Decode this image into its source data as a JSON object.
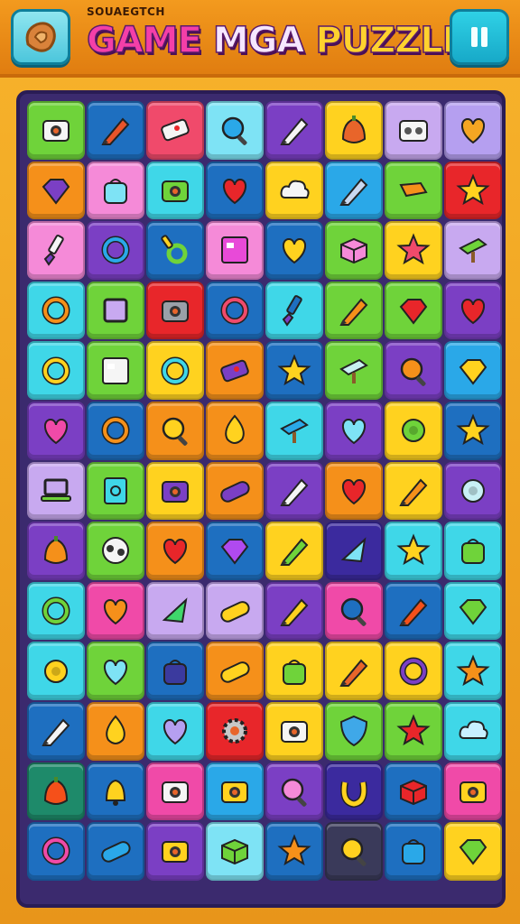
{
  "header": {
    "subtitle": "SOUAEGTCH",
    "title_part1": "GAME",
    "title_part2": "MGA",
    "title_part3": "PUZZLE",
    "menu_icon": "cookie-icon",
    "pause_icon": "pause-icon"
  },
  "board": {
    "columns": 8,
    "rows": 13,
    "tiles": [
      [
        "#6fd33a",
        "camera",
        "#f5f5f5"
      ],
      [
        "#1e6fc0",
        "pencil",
        "#e8542a"
      ],
      [
        "#f04a6b",
        "eraser",
        "#f5f5f5"
      ],
      [
        "#7ee3f5",
        "magnifier",
        "#2aa8e8"
      ],
      [
        "#7b3fc4",
        "pencil",
        "#f5f5f5"
      ],
      [
        "#ffd21f",
        "acorn",
        "#e8652a"
      ],
      [
        "#c8a9f0",
        "tape",
        "#f5f5f5"
      ],
      [
        "#b59ff0",
        "heart",
        "#f5a623"
      ],
      [
        "#f5901a",
        "gem",
        "#7b3fc4"
      ],
      [
        "#f58ad8",
        "bag",
        "#7ee3f5"
      ],
      [
        "#3fd7e8",
        "camera",
        "#6fd33a"
      ],
      [
        "#1e6fc0",
        "heart",
        "#e8262a"
      ],
      [
        "#ffd21f",
        "cloud",
        "#f5f5f5"
      ],
      [
        "#2aa8e8",
        "pencil",
        "#c8d8f0"
      ],
      [
        "#6fd33a",
        "block",
        "#f5901a"
      ],
      [
        "#e8262a",
        "star",
        "#ffd21f"
      ],
      [
        "#f58ad8",
        "brush",
        "#f5f5f5"
      ],
      [
        "#7b3fc4",
        "ring",
        "#2aa8e8"
      ],
      [
        "#1e6fc0",
        "key",
        "#6fd33a"
      ],
      [
        "#f58ad8",
        "card",
        "#e84ad8"
      ],
      [
        "#1e6fc0",
        "heart",
        "#ffd21f"
      ],
      [
        "#6fd33a",
        "box",
        "#f58ad8"
      ],
      [
        "#ffd21f",
        "star",
        "#f04a6b"
      ],
      [
        "#c8a9f0",
        "sign",
        "#6fd33a"
      ],
      [
        "#3fd7e8",
        "ring",
        "#f5901a"
      ],
      [
        "#6fd33a",
        "square",
        "#c8a9f0"
      ],
      [
        "#e8262a",
        "camera",
        "#9aa0a8"
      ],
      [
        "#1e6fc0",
        "ring",
        "#f04a6b"
      ],
      [
        "#3fd7e8",
        "brush",
        "#1e6fc0"
      ],
      [
        "#6fd33a",
        "pencil",
        "#f5901a"
      ],
      [
        "#6fd33a",
        "gem",
        "#e8262a"
      ],
      [
        "#7b3fc4",
        "heart",
        "#e8262a"
      ],
      [
        "#3fd7e8",
        "ring",
        "#ffd21f"
      ],
      [
        "#6fd33a",
        "card",
        "#f5f5f5"
      ],
      [
        "#ffd21f",
        "ring",
        "#3fd7e8"
      ],
      [
        "#f5901a",
        "eraser",
        "#7b3fc4"
      ],
      [
        "#1e6fc0",
        "star",
        "#ffd21f"
      ],
      [
        "#6fd33a",
        "sign",
        "#c8f0f0"
      ],
      [
        "#7b3fc4",
        "magnifier",
        "#f5901a"
      ],
      [
        "#2aa8e8",
        "gem",
        "#ffd21f"
      ],
      [
        "#7b3fc4",
        "heart",
        "#f04aa8"
      ],
      [
        "#1e6fc0",
        "ring",
        "#f5901a"
      ],
      [
        "#f5901a",
        "magnifier",
        "#ffd21f"
      ],
      [
        "#f5901a",
        "drop",
        "#ffd21f"
      ],
      [
        "#3fd7e8",
        "sign",
        "#2aa8e8"
      ],
      [
        "#7b3fc4",
        "heart",
        "#7ee3f5"
      ],
      [
        "#ffd21f",
        "flower",
        "#6fd33a"
      ],
      [
        "#1e6fc0",
        "star",
        "#ffd21f"
      ],
      [
        "#c8a9f0",
        "laptop",
        "#6fd33a"
      ],
      [
        "#6fd33a",
        "book",
        "#3fd7e8"
      ],
      [
        "#ffd21f",
        "camera",
        "#7b3fc4"
      ],
      [
        "#f5901a",
        "pill",
        "#7b3fc4"
      ],
      [
        "#7b3fc4",
        "pencil",
        "#f5f5f5"
      ],
      [
        "#f5901a",
        "heart",
        "#e8262a"
      ],
      [
        "#ffd21f",
        "pencil",
        "#f5901a"
      ],
      [
        "#7b3fc4",
        "flower",
        "#c8f0f5"
      ],
      [
        "#7b3fc4",
        "acorn",
        "#f5901a"
      ],
      [
        "#6fd33a",
        "ball",
        "#f5f5f5"
      ],
      [
        "#f5901a",
        "heart",
        "#e8262a"
      ],
      [
        "#1e6fc0",
        "gem",
        "#b04af0"
      ],
      [
        "#ffd21f",
        "pencil",
        "#6fd33a"
      ],
      [
        "#3b2a9e",
        "triangle",
        "#7ee3f5"
      ],
      [
        "#3fd7e8",
        "star",
        "#ffd21f"
      ],
      [
        "#3fd7e8",
        "bag",
        "#6fd33a"
      ],
      [
        "#3fd7e8",
        "ring",
        "#6fd33a"
      ],
      [
        "#f04aa8",
        "heart",
        "#f5901a"
      ],
      [
        "#c8a9f0",
        "triangle",
        "#3fd76b"
      ],
      [
        "#c8a9f0",
        "pill",
        "#ffd21f"
      ],
      [
        "#7b3fc4",
        "pencil",
        "#ffd21f"
      ],
      [
        "#f04aa8",
        "magnifier",
        "#1e6fc0"
      ],
      [
        "#1e6fc0",
        "pencil",
        "#f5501a"
      ],
      [
        "#3fd7e8",
        "gem",
        "#6fd33a"
      ],
      [
        "#3fd7e8",
        "flower",
        "#ffd21f"
      ],
      [
        "#6fd33a",
        "heart",
        "#7ee3f5"
      ],
      [
        "#1e6fc0",
        "bag",
        "#3b3a9e"
      ],
      [
        "#f5901a",
        "pill",
        "#ffd21f"
      ],
      [
        "#ffd21f",
        "bag",
        "#6fd33a"
      ],
      [
        "#ffd21f",
        "pencil",
        "#e8652a"
      ],
      [
        "#ffd21f",
        "ring",
        "#7b3fc4"
      ],
      [
        "#3fd7e8",
        "star",
        "#f5901a"
      ],
      [
        "#1e6fc0",
        "pencil",
        "#f5f5f5"
      ],
      [
        "#f5901a",
        "drop",
        "#ffd21f"
      ],
      [
        "#3fd7e8",
        "heart",
        "#b59ff0"
      ],
      [
        "#e8262a",
        "gear",
        "#c8c8c8"
      ],
      [
        "#ffd21f",
        "camera",
        "#f5f5f5"
      ],
      [
        "#6fd33a",
        "shield",
        "#3fa8e8"
      ],
      [
        "#6fd33a",
        "star",
        "#e8262a"
      ],
      [
        "#3fd7e8",
        "cloud",
        "#c8f0ff"
      ],
      [
        "#1e8a6a",
        "acorn",
        "#f5501a"
      ],
      [
        "#1e6fc0",
        "bell",
        "#ffd21f"
      ],
      [
        "#f04aa8",
        "camera",
        "#f5f5f5"
      ],
      [
        "#2aa8e8",
        "camera",
        "#ffd21f"
      ],
      [
        "#7b3fc4",
        "magnifier",
        "#f58ad8"
      ],
      [
        "#3b2a9e",
        "horseshoe",
        "#ffd21f"
      ],
      [
        "#1e6fc0",
        "box",
        "#e8262a"
      ],
      [
        "#f04aa8",
        "camera",
        "#ffd21f"
      ],
      [
        "#1e6fc0",
        "ring",
        "#f04aa8"
      ],
      [
        "#1e6fc0",
        "pill",
        "#2aa8e8"
      ],
      [
        "#7b3fc4",
        "camera",
        "#ffd21f"
      ],
      [
        "#7ee3f5",
        "box",
        "#6fd33a"
      ],
      [
        "#1e6fc0",
        "star",
        "#f5901a"
      ],
      [
        "#3a3a5a",
        "magnifier",
        "#ffd21f"
      ],
      [
        "#1e6fc0",
        "bag",
        "#2aa8e8"
      ],
      [
        "#ffd21f",
        "gem",
        "#6fd33a"
      ]
    ]
  }
}
